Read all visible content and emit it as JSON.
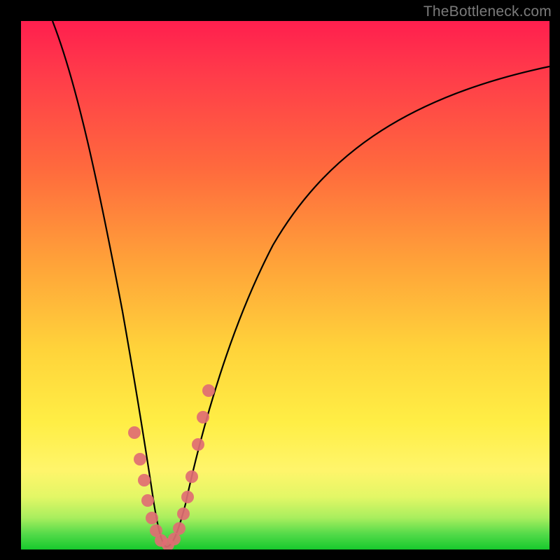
{
  "watermark": {
    "text": "TheBottleneck.com"
  },
  "chart_data": {
    "type": "line",
    "title": "",
    "xlabel": "",
    "ylabel": "",
    "xlim": [
      0,
      100
    ],
    "ylim": [
      0,
      100
    ],
    "grid": false,
    "legend": false,
    "curve": {
      "name": "bottleneck-curve",
      "x": [
        6,
        10,
        14,
        18,
        20,
        22,
        24,
        25,
        26,
        27,
        28,
        30,
        32,
        34,
        36,
        40,
        45,
        50,
        60,
        70,
        80,
        90,
        100
      ],
      "y": [
        100,
        85,
        65,
        42,
        30,
        18,
        8,
        3,
        1,
        0.5,
        1,
        3,
        8,
        16,
        26,
        40,
        53,
        63,
        76,
        83,
        87,
        90,
        92
      ]
    },
    "markers": {
      "name": "highlight-dots",
      "x": [
        21.5,
        22.5,
        23.2,
        24.0,
        24.8,
        25.5,
        26.5,
        27.8,
        29.0,
        30.0,
        30.8,
        31.5,
        32.3,
        33.5,
        34.5,
        35.5
      ],
      "y": [
        22,
        17,
        13,
        9,
        6,
        3.5,
        1.5,
        1,
        2,
        4,
        7,
        10,
        14,
        20,
        25,
        30
      ],
      "color": "#e06d73",
      "radius_px": 9
    },
    "gradient_stops": [
      {
        "pos": 0,
        "color": "#ff1f4e"
      },
      {
        "pos": 45,
        "color": "#ffa039"
      },
      {
        "pos": 76,
        "color": "#ffee45"
      },
      {
        "pos": 97,
        "color": "#55db4a"
      },
      {
        "pos": 100,
        "color": "#17c92d"
      }
    ]
  }
}
